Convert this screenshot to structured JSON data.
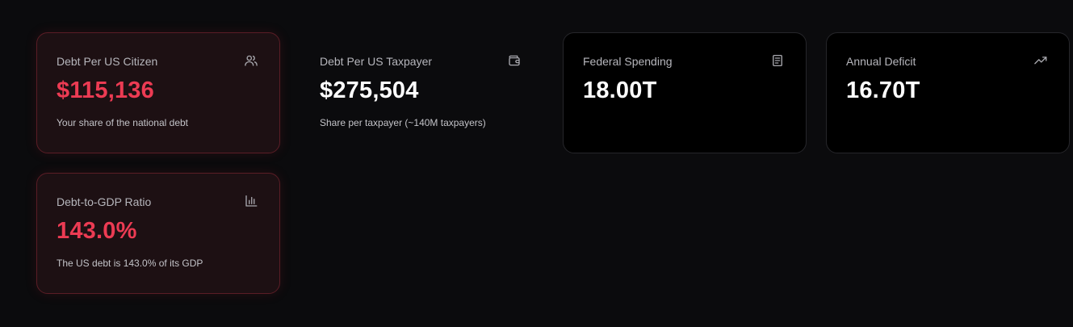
{
  "cards": [
    {
      "title": "Debt Per US Citizen",
      "value": "$115,136",
      "subtitle": "Your share of the national debt",
      "icon": "users-icon"
    },
    {
      "title": "Debt Per US Taxpayer",
      "value": "$275,504",
      "subtitle": "Share per taxpayer (~140M taxpayers)",
      "icon": "wallet-icon"
    },
    {
      "title": "Federal Spending",
      "value": "18.00T",
      "subtitle": "",
      "icon": "document-icon"
    },
    {
      "title": "Annual Deficit",
      "value": "16.70T",
      "subtitle": "",
      "icon": "trending-up-icon"
    },
    {
      "title": "Debt-to-GDP Ratio",
      "value": "143.0%",
      "subtitle": "The US debt is 143.0% of its GDP",
      "icon": "bar-chart-icon"
    }
  ],
  "colors": {
    "background": "#0b0b0d",
    "danger_value": "#ec3b53",
    "danger_card_bg": "#1d1013",
    "danger_card_border": "#5a1d26",
    "neutral_value": "#ffffff"
  }
}
